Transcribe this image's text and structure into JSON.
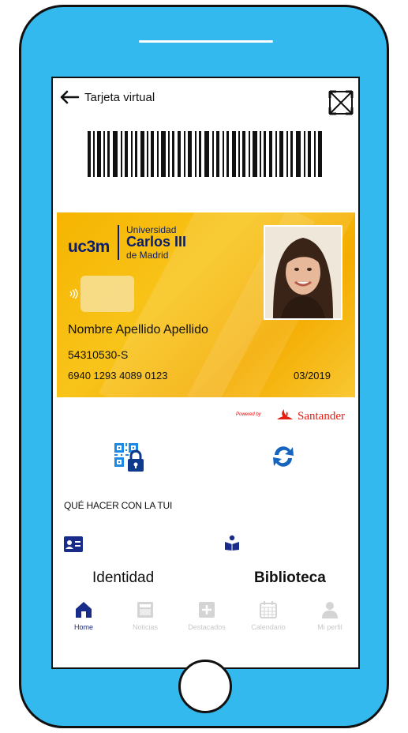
{
  "header": {
    "title": "Tarjeta virtual",
    "back_icon": "arrow-left-icon",
    "expand_icon": "expand-icon"
  },
  "card": {
    "logo_brand": "uc3m",
    "logo_line1": "Universidad",
    "logo_line2": "Carlos III",
    "logo_line3": "de Madrid",
    "holder_name": "Nombre Apellido Apellido",
    "document_id": "54310530-S",
    "card_number": "6940 1293 4089 0123",
    "expiry": "03/2019"
  },
  "sponsor": {
    "powered_by": "Powered by",
    "name": "Santander"
  },
  "actions": {
    "qr_icon": "qr-lock-icon",
    "sync_icon": "sync-icon"
  },
  "section": {
    "heading": "QUÉ HACER CON LA TUI",
    "items": [
      {
        "label": "Identidad",
        "icon": "id-card-icon"
      },
      {
        "label": "Biblioteca",
        "icon": "book-reader-icon"
      }
    ]
  },
  "tabs": [
    {
      "label": "Home",
      "icon": "home-icon",
      "active": true
    },
    {
      "label": "Noticias",
      "icon": "news-icon",
      "active": false
    },
    {
      "label": "Destacados",
      "icon": "plus-square-icon",
      "active": false
    },
    {
      "label": "Calendario",
      "icon": "calendar-icon",
      "active": false
    },
    {
      "label": "Mi perfil",
      "icon": "user-icon",
      "active": false
    }
  ],
  "colors": {
    "phone_frame": "#33b9ee",
    "card_gold": "#f6b400",
    "brand_navy": "#0a1d6b",
    "active_tab": "#1a2c8a",
    "santander_red": "#e41e13"
  }
}
